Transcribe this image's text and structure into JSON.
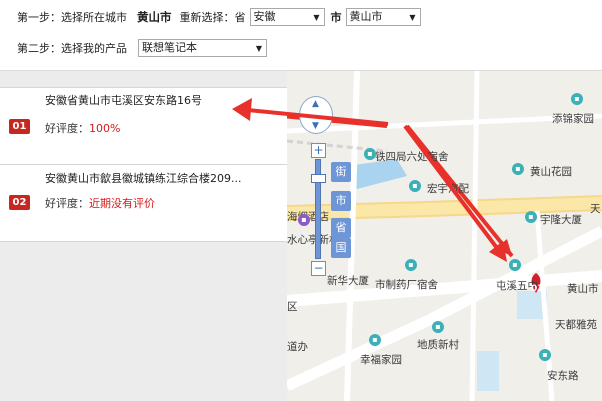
{
  "step1": {
    "label": "第一步：选择所在城市",
    "current_city": "黄山市",
    "reselect_label": "重新选择：省",
    "province_value": "安徽",
    "city_label": "市",
    "city_value": "黄山市"
  },
  "step2": {
    "label": "第二步：选择我的产品",
    "product_value": "联想笔记本"
  },
  "results": [
    {
      "num": "01",
      "address": "安徽省黄山市屯溪区安东路16号",
      "rating_label": "好评度：",
      "rating_value": "100%"
    },
    {
      "num": "02",
      "address": "安徽黄山市歙县徽城镇练江综合楼209...",
      "rating_label": "好评度：",
      "rating_value": "近期没有评价"
    }
  ],
  "map": {
    "labels": {
      "l1": "铁四局六处宿舍",
      "l2": "添锦家园",
      "l3": "黄山花园",
      "l4": "宏宇汽配",
      "l5": "宇隆大厦",
      "l6": "海烟酒店",
      "l7": "水心亭新村",
      "l8": "新华大厦",
      "l9": "市制药厂宿舍",
      "l10": "屯溪五中",
      "l11": "黄山市",
      "l12": "天都雅苑",
      "l13": "地质新村",
      "l14": "幸福家园",
      "l15": "安东路",
      "l16": "天",
      "l17": "区",
      "l18": "道办"
    },
    "zoom_levels": [
      "街",
      "市",
      "省",
      "国"
    ],
    "marker_label": "01"
  },
  "colors": {
    "accent_red": "#c6281f",
    "arrow_red": "#e8312a",
    "map_blue": "#6e95d6"
  }
}
